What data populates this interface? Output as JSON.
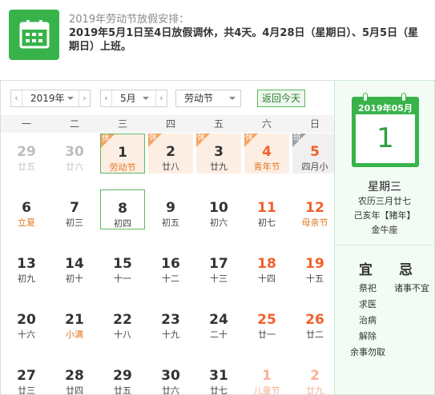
{
  "notice": {
    "title": "2019年劳动节放假安排：",
    "body": "2019年5月1日至4日放假调休，共4天。4月28日（星期日）、5月5日（星期日）上班。",
    "icon": "calendar-icon"
  },
  "toolbar": {
    "year_value": "2019年",
    "month_value": "5月",
    "holiday_value": "劳动节",
    "today_button": "返回今天",
    "prev_arrow": "‹",
    "next_arrow": "›"
  },
  "weekdays": [
    "一",
    "二",
    "三",
    "四",
    "五",
    "六",
    "日"
  ],
  "tags": {
    "rest": "休",
    "work": "班"
  },
  "days": [
    {
      "num": "29",
      "lunar": "廿五",
      "other": true,
      "weekend": false
    },
    {
      "num": "30",
      "lunar": "廿六",
      "other": true,
      "weekend": false
    },
    {
      "num": "1",
      "lunar": "劳动节",
      "other": false,
      "weekend": false,
      "holiday": true,
      "today": true,
      "festival": true
    },
    {
      "num": "2",
      "lunar": "廿八",
      "other": false,
      "weekend": false,
      "holiday": true
    },
    {
      "num": "3",
      "lunar": "廿九",
      "other": false,
      "weekend": false,
      "holiday": true
    },
    {
      "num": "4",
      "lunar": "青年节",
      "other": false,
      "weekend": true,
      "holiday": true,
      "festival": true
    },
    {
      "num": "5",
      "lunar": "四月小",
      "other": false,
      "weekend": true,
      "workday": true
    },
    {
      "num": "6",
      "lunar": "立夏",
      "other": false,
      "weekend": false,
      "festival": true
    },
    {
      "num": "7",
      "lunar": "初三",
      "other": false,
      "weekend": false
    },
    {
      "num": "8",
      "lunar": "初四",
      "other": false,
      "weekend": false,
      "selected": true
    },
    {
      "num": "9",
      "lunar": "初五",
      "other": false,
      "weekend": false
    },
    {
      "num": "10",
      "lunar": "初六",
      "other": false,
      "weekend": false
    },
    {
      "num": "11",
      "lunar": "初七",
      "other": false,
      "weekend": true
    },
    {
      "num": "12",
      "lunar": "母亲节",
      "other": false,
      "weekend": true,
      "festival": true
    },
    {
      "num": "13",
      "lunar": "初九",
      "other": false,
      "weekend": false
    },
    {
      "num": "14",
      "lunar": "初十",
      "other": false,
      "weekend": false
    },
    {
      "num": "15",
      "lunar": "十一",
      "other": false,
      "weekend": false
    },
    {
      "num": "16",
      "lunar": "十二",
      "other": false,
      "weekend": false
    },
    {
      "num": "17",
      "lunar": "十三",
      "other": false,
      "weekend": false
    },
    {
      "num": "18",
      "lunar": "十四",
      "other": false,
      "weekend": true
    },
    {
      "num": "19",
      "lunar": "十五",
      "other": false,
      "weekend": true
    },
    {
      "num": "20",
      "lunar": "十六",
      "other": false,
      "weekend": false
    },
    {
      "num": "21",
      "lunar": "小满",
      "other": false,
      "weekend": false,
      "festival": true
    },
    {
      "num": "22",
      "lunar": "十八",
      "other": false,
      "weekend": false
    },
    {
      "num": "23",
      "lunar": "十九",
      "other": false,
      "weekend": false
    },
    {
      "num": "24",
      "lunar": "二十",
      "other": false,
      "weekend": false
    },
    {
      "num": "25",
      "lunar": "廿一",
      "other": false,
      "weekend": true
    },
    {
      "num": "26",
      "lunar": "廿二",
      "other": false,
      "weekend": true
    },
    {
      "num": "27",
      "lunar": "廿三",
      "other": false,
      "weekend": false
    },
    {
      "num": "28",
      "lunar": "廿四",
      "other": false,
      "weekend": false
    },
    {
      "num": "29",
      "lunar": "廿五",
      "other": false,
      "weekend": false
    },
    {
      "num": "30",
      "lunar": "廿六",
      "other": false,
      "weekend": false
    },
    {
      "num": "31",
      "lunar": "廿七",
      "other": false,
      "weekend": false
    },
    {
      "num": "1",
      "lunar": "儿童节",
      "other": true,
      "weekend": true,
      "festival": true
    },
    {
      "num": "2",
      "lunar": "廿九",
      "other": true,
      "weekend": true
    }
  ],
  "panel": {
    "header": "2019年05月",
    "day": "1",
    "weekday": "星期三",
    "lunar": "农历三月廿七",
    "ganzhi": "己亥年【猪年】",
    "constellation": "金牛座",
    "yi_title": "宜",
    "ji_title": "忌",
    "yi": [
      "祭祀",
      "求医",
      "治病",
      "解除",
      "余事勿取"
    ],
    "ji": [
      "诸事不宜"
    ]
  },
  "colors": {
    "brand_green": "#37b34a",
    "weekend_orange": "#f1602b",
    "holiday_bg": "#fdeee4",
    "rest_tag": "#f5a462",
    "work_tag": "#9aa0a6"
  }
}
